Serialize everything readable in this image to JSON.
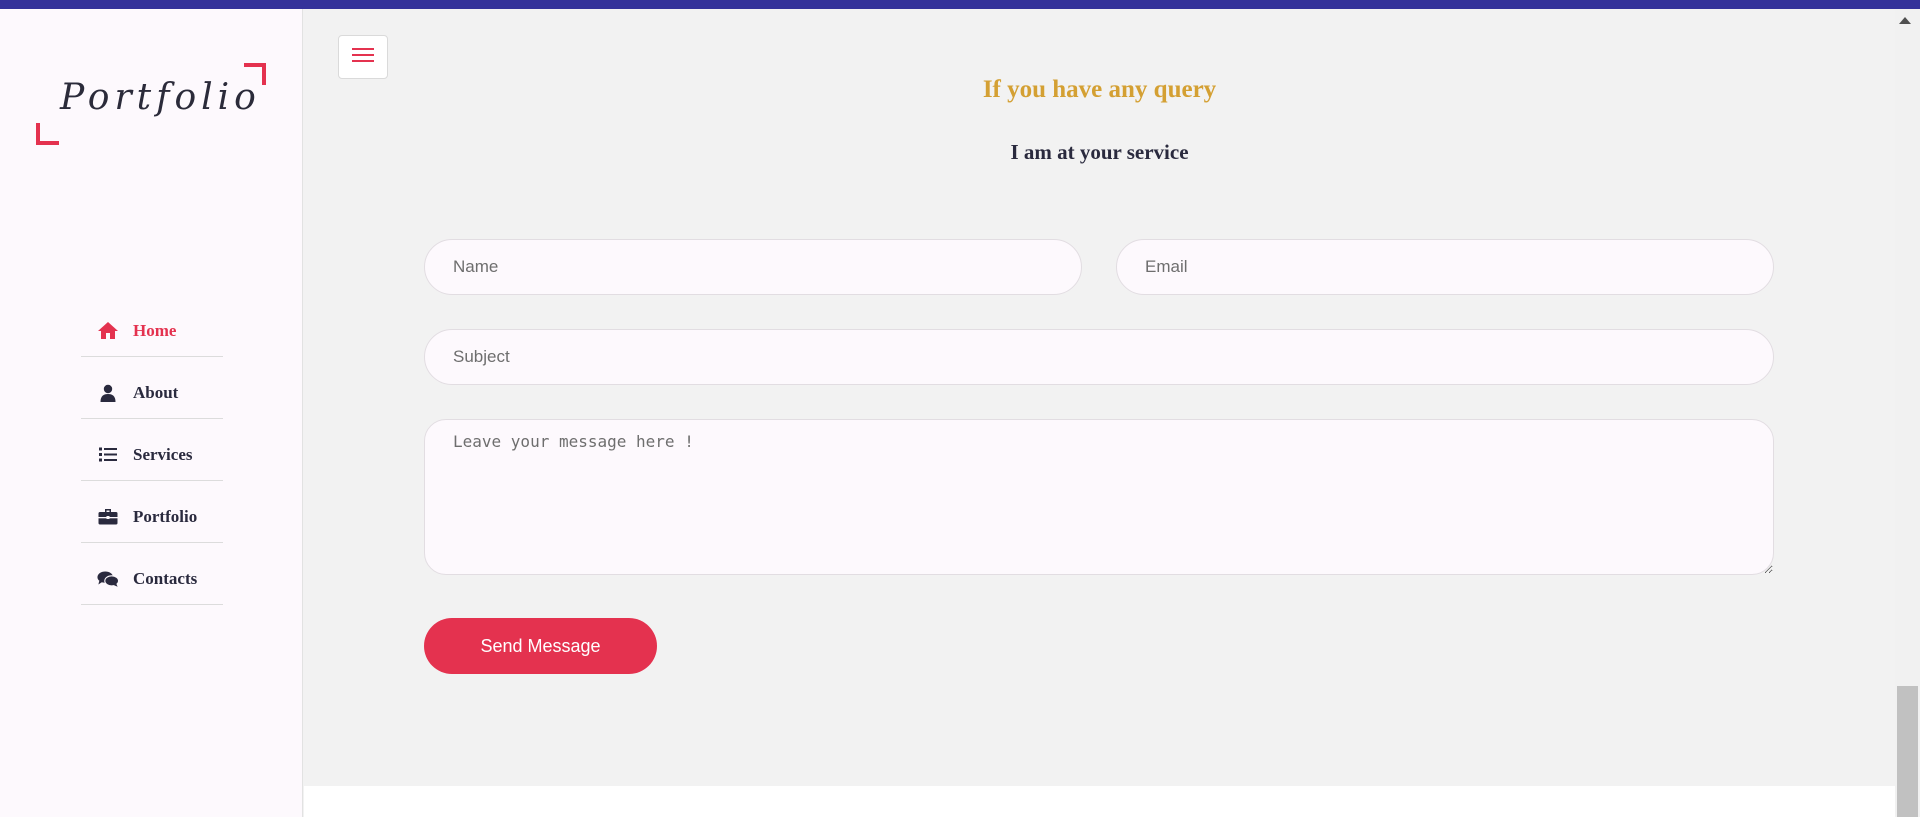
{
  "colors": {
    "accent": "#e4324f",
    "heading_gold": "#d4a033",
    "dark_text": "#2a2a3e",
    "top_bar": "#34329a"
  },
  "sidebar": {
    "logo_text": "Portfolio",
    "items": [
      {
        "label": "Home",
        "icon": "home-icon",
        "active": true
      },
      {
        "label": "About",
        "icon": "user-icon",
        "active": false
      },
      {
        "label": "Services",
        "icon": "list-icon",
        "active": false
      },
      {
        "label": "Portfolio",
        "icon": "briefcase-icon",
        "active": false
      },
      {
        "label": "Contacts",
        "icon": "comments-icon",
        "active": false
      }
    ]
  },
  "header": {
    "menu_icon": "hamburger-menu-icon"
  },
  "contact": {
    "heading": "If you have any query",
    "subheading": "I am at your service",
    "name_placeholder": "Name",
    "email_placeholder": "Email",
    "subject_placeholder": "Subject",
    "message_placeholder": "Leave your message here !",
    "send_label": "Send Message"
  }
}
